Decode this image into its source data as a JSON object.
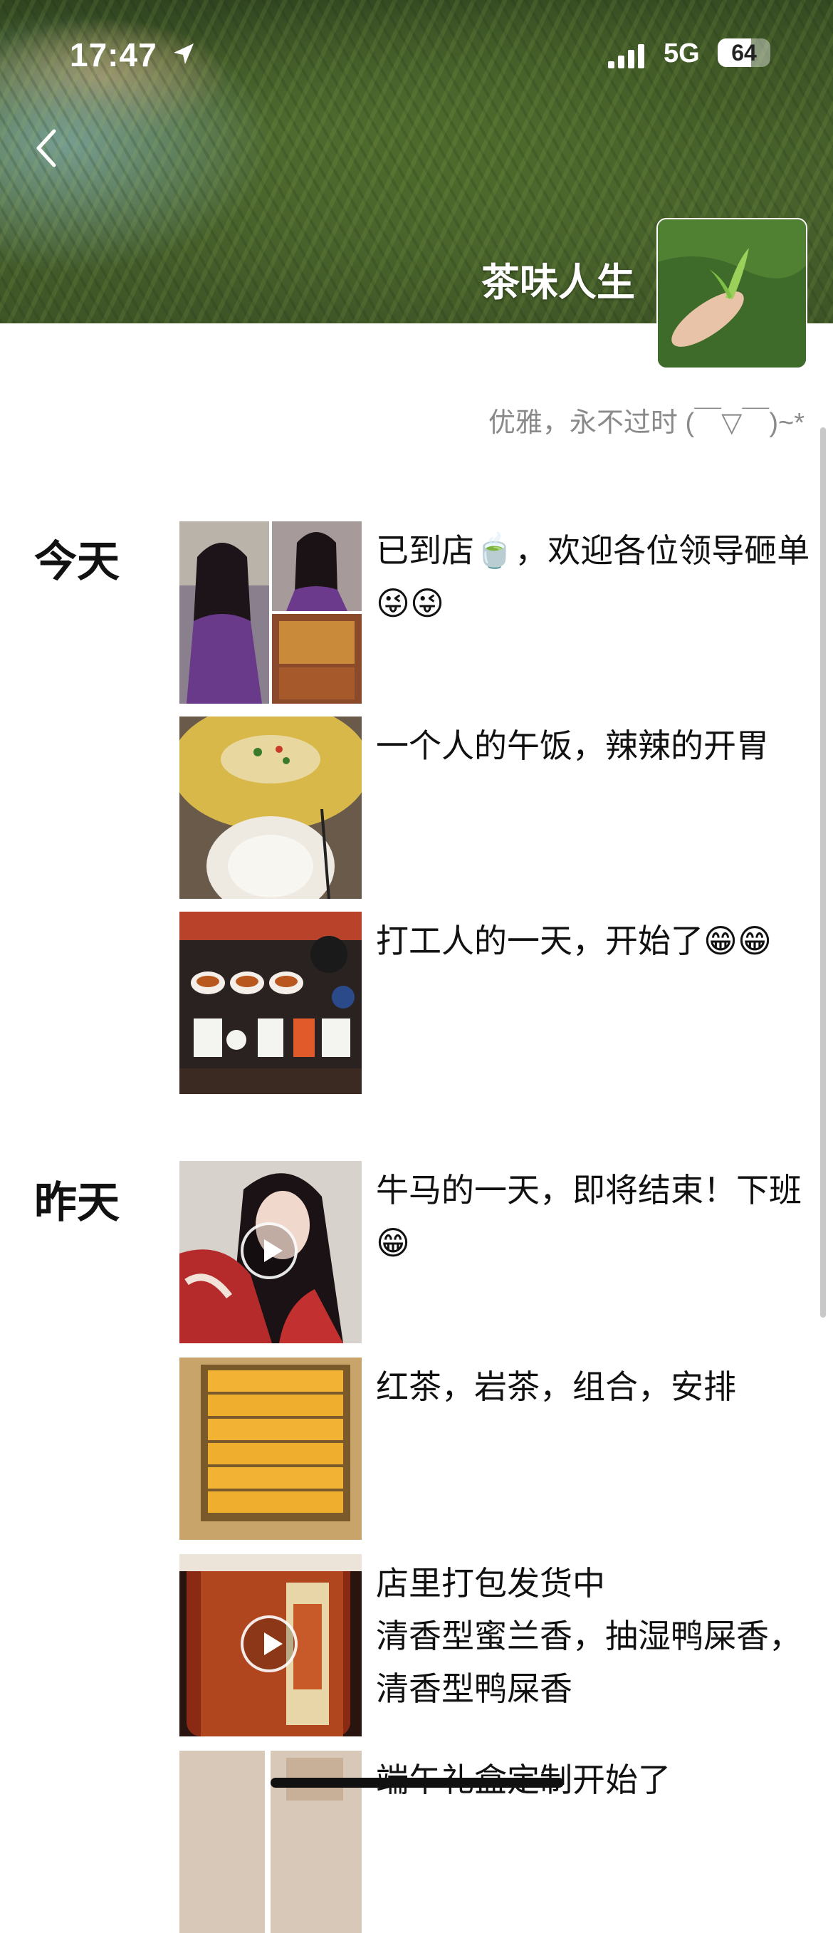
{
  "status_bar": {
    "time": "17:47",
    "network": "5G",
    "battery": "64",
    "battery_level": 0.64
  },
  "profile": {
    "nickname": "茶味人生",
    "signature": "优雅，永不过时 (￣▽￣)~*"
  },
  "sections": [
    {
      "day": "今天",
      "posts": [
        {
          "text": "已到店🍵，欢迎各位领导砸单😜😜",
          "media": "photos"
        },
        {
          "text": "一个人的午饭，辣辣的开胃",
          "media": "photo"
        },
        {
          "text": "打工人的一天，开始了😁😁",
          "media": "photo"
        }
      ]
    },
    {
      "day": "昨天",
      "posts": [
        {
          "text": "牛马的一天，即将结束！下班😁",
          "media": "video"
        },
        {
          "text": "红茶，岩茶，组合，安排",
          "media": "photo"
        },
        {
          "text": "店里打包发货中\n清香型蜜兰香，抽湿鸭屎香，清香型鸭屎香",
          "media": "video"
        },
        {
          "text": "端午礼盒定制开始了",
          "media": "photo"
        }
      ]
    }
  ]
}
